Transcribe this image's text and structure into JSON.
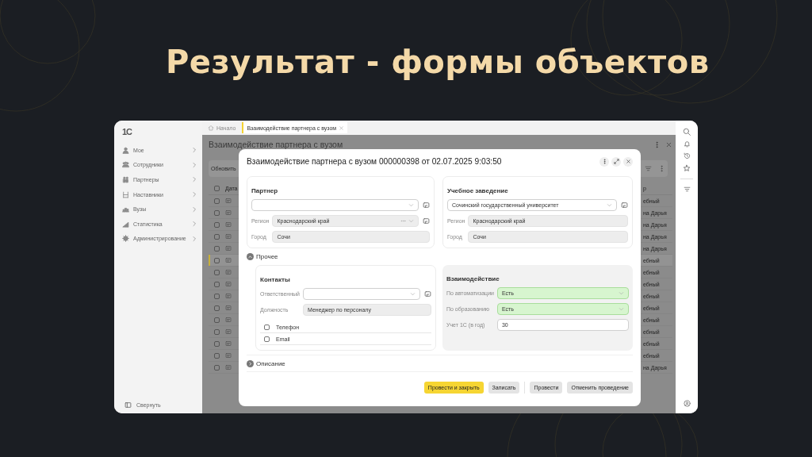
{
  "slide_title": "Результат - формы объектов",
  "app": {
    "logo": "1С",
    "sidebar": {
      "items": [
        {
          "label": "Мое"
        },
        {
          "label": "Сотрудники"
        },
        {
          "label": "Партнеры"
        },
        {
          "label": "Наставники"
        },
        {
          "label": "Вузы"
        },
        {
          "label": "Статистика"
        },
        {
          "label": "Администрирование"
        }
      ],
      "collapse": "Свернуть"
    },
    "tabs": [
      {
        "label": "Начало",
        "kind": "home",
        "selected": false
      },
      {
        "label": "Взаимодействие партнера с вузом",
        "kind": "document",
        "selected": true
      }
    ],
    "page": {
      "title": "Взаимодействие партнера с вузом",
      "toolbar": [
        "Обновить"
      ],
      "list": {
        "columns": [
          "Дата",
          "р"
        ],
        "all_checked": false,
        "rows": [
          {
            "checked": false,
            "selected": false,
            "column_2": "ебный"
          },
          {
            "checked": false,
            "selected": false,
            "column_2": "на Дарья"
          },
          {
            "checked": false,
            "selected": false,
            "column_2": "на Дарья"
          },
          {
            "checked": false,
            "selected": false,
            "column_2": "на Дарья"
          },
          {
            "checked": false,
            "selected": false,
            "column_2": "на Дарья"
          },
          {
            "checked": false,
            "selected": true,
            "column_2": "ебный"
          },
          {
            "checked": false,
            "selected": false,
            "column_2": "ебный"
          },
          {
            "checked": false,
            "selected": false,
            "column_2": "ебный"
          },
          {
            "checked": false,
            "selected": false,
            "column_2": "ебный"
          },
          {
            "checked": false,
            "selected": false,
            "column_2": "ебный"
          },
          {
            "checked": false,
            "selected": false,
            "column_2": "ебный"
          },
          {
            "checked": false,
            "selected": false,
            "column_2": "ебный"
          },
          {
            "checked": false,
            "selected": false,
            "column_2": "ебный"
          },
          {
            "checked": false,
            "selected": false,
            "column_2": "ебный"
          },
          {
            "checked": false,
            "selected": false,
            "column_2": "на Дарья"
          }
        ]
      }
    },
    "dialog": {
      "title": "Взаимодействие партнера с вузом 000000398 от 02.07.2025 9:03:50",
      "groups": [
        {
          "title": "Партнер",
          "kind": "card",
          "fields": [
            {
              "kind": "combo",
              "open_button": true
            },
            {
              "kind": "locked-combo",
              "label": "Регион",
              "value": "Краснодарский край",
              "open_button": true
            },
            {
              "kind": "readonly",
              "label": "Город",
              "value": "Сочи",
              "open_button": false
            }
          ]
        },
        {
          "title": "Учебное заведение",
          "kind": "card",
          "fields": [
            {
              "kind": "combo",
              "value": "Сочинский государственный университет",
              "open_button": true
            },
            {
              "kind": "readonly",
              "label": "Регион",
              "value": "Краснодарский край",
              "open_button": false
            },
            {
              "kind": "readonly",
              "label": "Город",
              "value": "Сочи",
              "open_button": false
            }
          ]
        }
      ],
      "sections": [
        {
          "title": "Прочее",
          "expanded": true,
          "groups": [
            {
              "title": "Контакты",
              "kind": "card",
              "fields": [
                {
                  "kind": "combo",
                  "label": "Ответственный",
                  "open_button": true
                },
                {
                  "kind": "readonly",
                  "label": "Должность",
                  "value": "Менеджер по персоналу",
                  "open_button": false
                }
              ],
              "checks": [
                {
                  "label": "Телефон",
                  "checked": false
                },
                {
                  "label": "Email",
                  "checked": false
                }
              ]
            },
            {
              "title": "Взаимодействие",
              "kind": "panel",
              "fields": [
                {
                  "kind": "combo",
                  "label": "По автоматизации",
                  "value": "Есть",
                  "highlighted": true,
                  "open_button": false
                },
                {
                  "kind": "combo",
                  "label": "По образованию",
                  "value": "Есть",
                  "highlighted": true,
                  "open_button": false
                },
                {
                  "kind": "input",
                  "label": "Учет 1С (в год)",
                  "value": "30",
                  "open_button": false
                }
              ]
            }
          ]
        },
        {
          "title": "Описание",
          "expanded": false
        }
      ],
      "buttons": [
        [
          {
            "label": "Провести и закрыть",
            "kind": "primary"
          },
          {
            "label": "Записать",
            "kind": "normal"
          }
        ],
        [
          {
            "label": "Провести",
            "kind": "normal"
          },
          {
            "label": "Отменить проведение",
            "kind": "normal"
          }
        ]
      ]
    }
  }
}
